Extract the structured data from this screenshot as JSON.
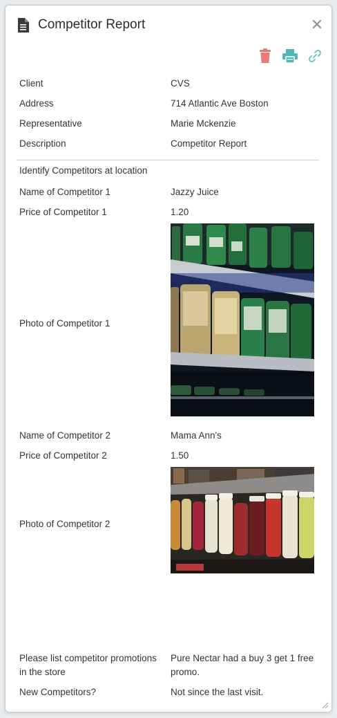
{
  "header": {
    "title": "Competitor Report",
    "doc_icon": "document-icon",
    "close_icon": "close-icon"
  },
  "toolbar": {
    "delete_icon": "trash-icon",
    "print_icon": "printer-icon",
    "link_icon": "link-icon",
    "delete_color": "#e87a7a",
    "print_color": "#4fb8b2",
    "link_color": "#6fc9c0"
  },
  "details": {
    "client_label": "Client",
    "client_value": "CVS",
    "address_label": "Address",
    "address_value": "714 Atlantic Ave Boston",
    "rep_label": "Representative",
    "rep_value": "Marie Mckenzie",
    "desc_label": "Description",
    "desc_value": "Competitor Report"
  },
  "form": {
    "section_title": "Identify Competitors at location",
    "c1_name_label": "Name of Competitor 1",
    "c1_name_value": "Jazzy Juice",
    "c1_price_label": "Price of Competitor 1",
    "c1_price_value": "1.20",
    "c1_photo_label": "Photo of Competitor 1",
    "c2_name_label": "Name of Competitor 2",
    "c2_name_value": "Mama Ann's",
    "c2_price_label": "Price of Competitor 2",
    "c2_price_value": "1.50",
    "c2_photo_label": "Photo of Competitor 2",
    "promo_label": "Please list competitor promotions in the store",
    "promo_value": "Pure Nectar had a buy 3 get 1 free promo.",
    "new_label": "New Competitors?",
    "new_value": "Not since the last visit."
  }
}
